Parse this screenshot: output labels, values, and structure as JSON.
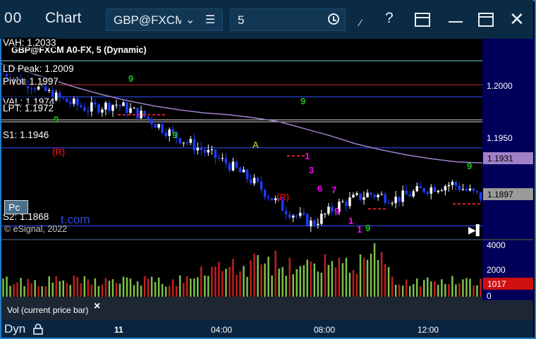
{
  "window": {
    "logo": "00",
    "title": "Chart",
    "symbol": "GBP@FXCM",
    "interval": "5"
  },
  "chart": {
    "title": "GBP@FXCM A0-FX, 5 (Dynamic)",
    "levels": {
      "vah": "VAH: 1.2033",
      "ld_peak": "LD Peak: 1.2009",
      "pivot": "Pivot: 1.1997",
      "val": "VAL: 1.1974",
      "lpt": "LPT: 1.1972",
      "s1": "S1: 1.1946",
      "s2": "S2: 1.1868"
    },
    "pc_button": "Pc",
    "watermark": "t.com",
    "copyright": "© eSignal, 2022",
    "markers": {
      "r1": "(R)",
      "r2": "(R)",
      "a": "A",
      "seq": [
        "9",
        "1",
        "3",
        "6",
        "7",
        "9",
        "1",
        "1",
        "9",
        "9",
        "9",
        "9",
        "9"
      ]
    }
  },
  "price_axis": {
    "labels": [
      "1.2000",
      "1.1950"
    ],
    "current_tag": "1.1931",
    "last_tag": "1.1897"
  },
  "volume": {
    "legend": "Vol (current price bar)",
    "labels": [
      "4000",
      "2000",
      "0"
    ],
    "current_tag": "1017"
  },
  "time_axis": {
    "dyn": "Dyn",
    "labels": [
      "11",
      "04:00",
      "08:00",
      "12:00"
    ]
  },
  "chart_data": {
    "type": "candlestick",
    "series": [
      {
        "name": "GBP@FXCM",
        "approx_close": [
          1.202,
          1.201,
          1.1995,
          1.1985,
          1.199,
          1.1978,
          1.196,
          1.1945,
          1.193,
          1.191,
          1.1885,
          1.187,
          1.189,
          1.19,
          1.1895,
          1.1905,
          1.191,
          1.1897
        ]
      }
    ],
    "y_range": [
      1.1855,
      1.2055
    ],
    "volume_range": [
      0,
      4000
    ]
  },
  "colors": {
    "accent": "#1e7fd0",
    "titlebar": "#0b2a44",
    "axis_bg": "#00005a",
    "up_bar": "#ffffff",
    "down_bar": "#1e3cff",
    "ma_line": "#a081c8",
    "magenta": "#ff00ff",
    "green_seq": "#1fbf1f"
  }
}
